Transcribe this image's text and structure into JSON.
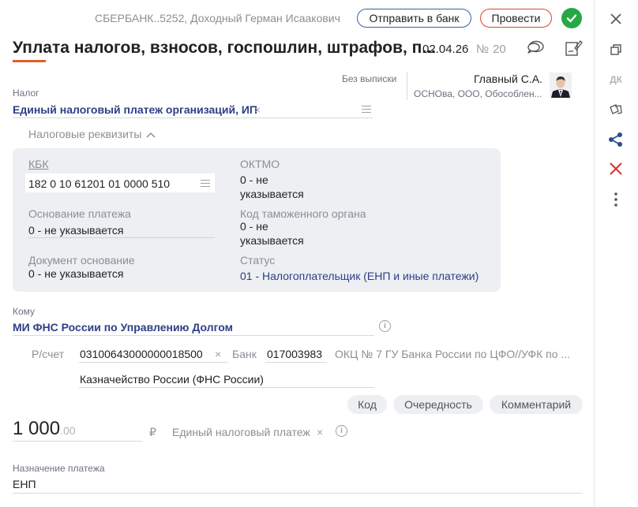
{
  "header": {
    "org_line": "СБЕРБАНК..5252, Доходный Герман Исаакович",
    "send_bank_label": "Отправить в банк",
    "post_label": "Провести",
    "title": "Уплата налогов, взносов, госпошлин, штрафов, п...",
    "date": "02.04.26",
    "number_sign": "№",
    "number": "20"
  },
  "statement": {
    "label": "Без выписки"
  },
  "signer": {
    "name": "Главный С.А.",
    "details": "ОСНОва, ООО, Обособлен..."
  },
  "tax": {
    "label": "Налог",
    "value": "Единый налоговый платеж организаций, ИП",
    "requisites_toggle": "Налоговые реквизиты"
  },
  "requisites": {
    "kbk_label": "КБК",
    "kbk_value": "182 0 10 61201 01 0000 510",
    "oktmo_label": "ОКТМО",
    "oktmo_value_1": "0 - не",
    "oktmo_value_2": "указывается",
    "basis_label": "Основание платежа",
    "basis_value": "0 - не указывается",
    "customs_label": "Код таможенного органа",
    "customs_value_1": "0 - не",
    "customs_value_2": "указывается",
    "doc_basis_label": "Документ основание",
    "doc_basis_value": "0 - не указывается",
    "status_label": "Статус",
    "status_value": "01 - Налогоплательщик (ЕНП и иные платежи)"
  },
  "recipient": {
    "label": "Кому",
    "value": "МИ ФНС России по Управлению Долгом",
    "account_label": "Р/счет",
    "account_value": "03100643000000018500",
    "bank_label": "Банк",
    "bik_value": "017003983",
    "bank_name": "ОКЦ № 7 ГУ Банка России по ЦФО//УФК по ...",
    "treasury": "Казначейство России (ФНС России)"
  },
  "chips": {
    "code": "Код",
    "priority": "Очередность",
    "comment": "Комментарий"
  },
  "amount": {
    "integer": "1 000",
    "fraction": ".00",
    "currency": "₽",
    "payment_kind": "Единый налоговый платеж"
  },
  "purpose": {
    "label": "Назначение платежа",
    "value": "ЕНП"
  },
  "rightbar": {
    "dk_label": "ДК"
  },
  "colors": {
    "accent_orange": "#e0602a",
    "link_blue": "#2d3f86",
    "ok_green": "#27a845",
    "delete_red": "#d9302a",
    "share_blue": "#2d4d8a"
  }
}
